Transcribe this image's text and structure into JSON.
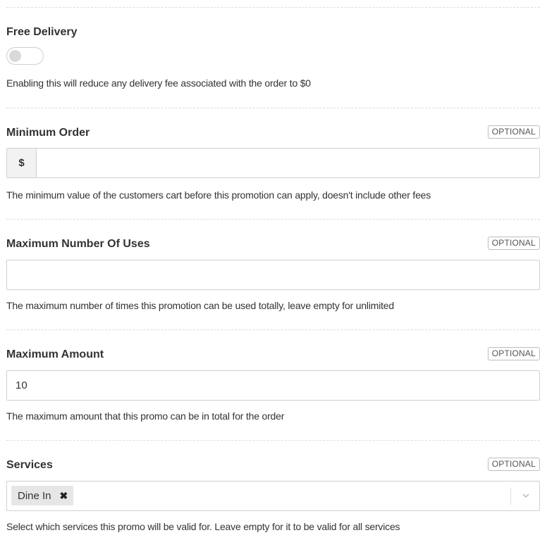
{
  "free_delivery": {
    "label": "Free Delivery",
    "enabled": false,
    "help": "Enabling this will reduce any delivery fee associated with the order to $0"
  },
  "minimum_order": {
    "label": "Minimum Order",
    "badge": "OPTIONAL",
    "prefix": "$",
    "value": "",
    "help": "The minimum value of the customers cart before this promotion can apply, doesn't include other fees"
  },
  "max_uses": {
    "label": "Maximum Number Of Uses",
    "badge": "OPTIONAL",
    "value": "",
    "help": "The maximum number of times this promotion can be used totally, leave empty for unlimited"
  },
  "max_amount": {
    "label": "Maximum Amount",
    "badge": "OPTIONAL",
    "value": "10",
    "help": "The maximum amount that this promo can be in total for the order"
  },
  "services": {
    "label": "Services",
    "badge": "OPTIONAL",
    "selected": [
      "Dine In"
    ],
    "remove_glyph": "✖",
    "help": "Select which services this promo will be valid for. Leave empty for it to be valid for all services"
  },
  "icons": {
    "toggle": "toggle-switch",
    "remove": "close-icon",
    "dropdown": "chevron-down-icon"
  }
}
